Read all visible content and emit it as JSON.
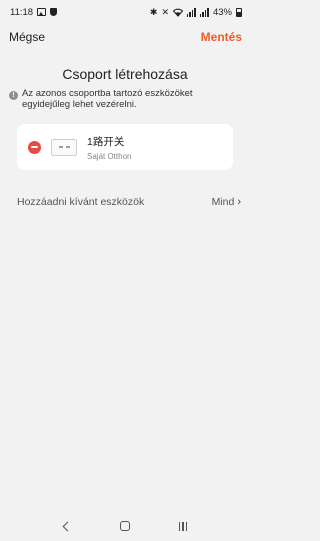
{
  "status_bar": {
    "time": "11:18",
    "battery": "43%",
    "icons": [
      "gallery-icon",
      "shield-icon",
      "bluetooth-icon",
      "mute-icon",
      "wifi-icon",
      "signal-icon",
      "battery-icon"
    ]
  },
  "topbar": {
    "cancel_label": "Mégse",
    "save_label": "Mentés",
    "save_color": "#f25c2b"
  },
  "page": {
    "title": "Csoport létrehozása",
    "info_text": "Az azonos csoportba tartozó eszközöket egyidejűleg lehet vezérelni."
  },
  "devices": [
    {
      "name": "1路开关",
      "room": "Saját Otthon",
      "remove_color": "#e84a3f"
    }
  ],
  "add_section": {
    "label": "Hozzáadni kívánt eszközök",
    "all_label": "Mind"
  },
  "nav_bar": {
    "buttons": [
      "back-icon",
      "home-icon",
      "recent-apps-icon"
    ]
  }
}
